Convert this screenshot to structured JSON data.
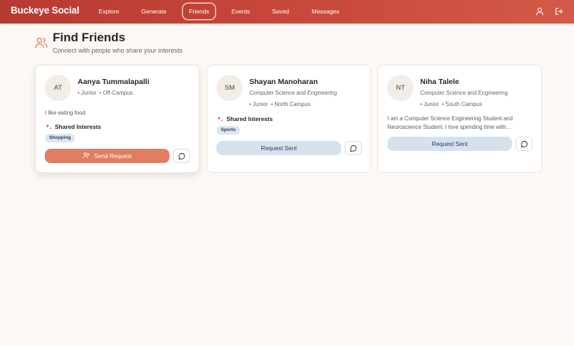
{
  "app": {
    "brand": "Buckeye Social"
  },
  "nav": {
    "links": [
      {
        "label": "Explore"
      },
      {
        "label": "Generate"
      },
      {
        "label": "Friends",
        "active": true
      },
      {
        "label": "Events"
      },
      {
        "label": "Saved"
      },
      {
        "label": "Messages"
      }
    ],
    "icons": [
      "user-icon",
      "logout-icon"
    ]
  },
  "page": {
    "icon": "users-icon",
    "title": "Find Friends",
    "subtitle": "Connect with people who share your interests"
  },
  "cards": [
    {
      "initials": "AT",
      "name": "Aanya Tummalapalli",
      "year": "Junior",
      "location": "Off-Campus",
      "bio": "I like eating food",
      "shared_label": "Shared Interests",
      "interests": [
        "Shopping"
      ],
      "action_label": "Send Request",
      "action_state": "send"
    },
    {
      "initials": "SM",
      "name": "Shayan Manoharan",
      "major": "Computer Science and Engineering",
      "year": "Junior",
      "location": "North Campus",
      "shared_label": "Shared Interests",
      "interests": [
        "Sports"
      ],
      "action_label": "Request Sent",
      "action_state": "sent"
    },
    {
      "initials": "NT",
      "name": "Niha Talele",
      "major": "Computer Science and Engineering",
      "year": "Junior",
      "location": "South Campus",
      "bio": "I am a Computer Science Engineering Student and Neuroscience Student. I love spending time with…",
      "action_label": "Request Sent",
      "action_state": "sent"
    }
  ],
  "colors": {
    "nav_start": "#b73a30",
    "nav_end": "#d35a48",
    "page_bg": "#fdf8f3",
    "primary_button": "#e07d63",
    "sent_button": "#d4e2ee",
    "tag_bg": "#dbe6f0",
    "accent_icon": "#e07d63"
  }
}
